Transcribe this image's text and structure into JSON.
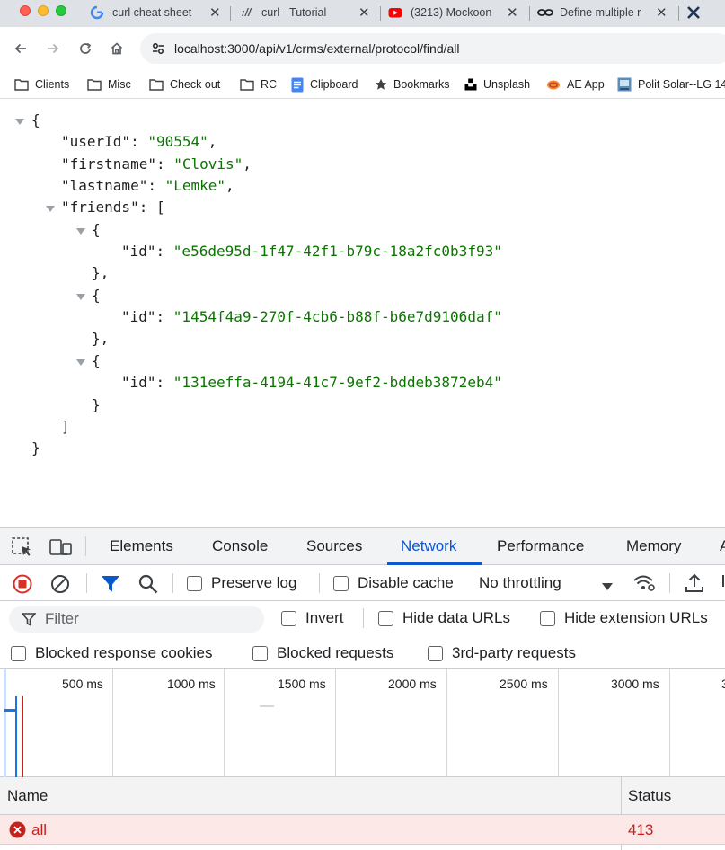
{
  "tabs": [
    {
      "title": "curl cheat sheet",
      "icon": "google-icon"
    },
    {
      "title": "curl - Tutorial",
      "icon": "slashes-icon"
    },
    {
      "title": "(3213) Mockoon",
      "icon": "youtube-icon"
    },
    {
      "title": "Define multiple r",
      "icon": "eye-link-icon"
    },
    {
      "title": "",
      "icon": "x-logo-icon"
    }
  ],
  "address": {
    "url": "localhost:3000/api/v1/crms/external/protocol/find/all"
  },
  "bookmarks": [
    {
      "label": "Clients",
      "icon": "folder-icon"
    },
    {
      "label": "Misc",
      "icon": "folder-icon"
    },
    {
      "label": "Check out",
      "icon": "folder-icon"
    },
    {
      "label": "RC",
      "icon": "folder-icon"
    },
    {
      "label": "Clipboard",
      "icon": "docs-icon"
    },
    {
      "label": "Bookmarks",
      "icon": "star-icon"
    },
    {
      "label": "Unsplash",
      "icon": "unsplash-icon"
    },
    {
      "label": "AE App",
      "icon": "ae-app-icon"
    },
    {
      "label": "Polit Solar--LG 14",
      "icon": "polit-solar-icon"
    }
  ],
  "json": {
    "open_brace": "{",
    "close_brace": "}",
    "userId_key": "\"userId\"",
    "userId_val": "\"90554\"",
    "firstname_key": "\"firstname\"",
    "firstname_val": "\"Clovis\"",
    "lastname_key": "\"lastname\"",
    "lastname_val": "\"Lemke\"",
    "friends_key": "\"friends\"",
    "open_bracket": "[",
    "close_bracket": "]",
    "id_key": "\"id\"",
    "friends": [
      {
        "id": "\"e56de95d-1f47-42f1-b79c-18a2fc0b3f93\""
      },
      {
        "id": "\"1454f4a9-270f-4cb6-b88f-b6e7d9106daf\""
      },
      {
        "id": "\"131eeffa-4194-41c7-9ef2-bddeb3872eb4\""
      }
    ]
  },
  "devtools": {
    "tabs": [
      "Elements",
      "Console",
      "Sources",
      "Network",
      "Performance",
      "Memory",
      "A"
    ],
    "active_tab": "Network",
    "toolbar": {
      "preserve_log": "Preserve log",
      "disable_cache": "Disable cache",
      "throttling": "No throttling"
    },
    "filter": {
      "placeholder": "Filter",
      "invert": "Invert",
      "hide_data_urls": "Hide data URLs",
      "hide_extension_urls": "Hide extension URLs"
    },
    "blocked": {
      "blocked_cookies": "Blocked response cookies",
      "blocked_requests": "Blocked requests",
      "third_party": "3rd-party requests"
    },
    "timeline_ticks": [
      "500 ms",
      "1000 ms",
      "1500 ms",
      "2000 ms",
      "2500 ms",
      "3000 ms",
      "3"
    ],
    "columns": {
      "name": "Name",
      "status": "Status"
    },
    "requests": [
      {
        "name": "all",
        "status": "413"
      }
    ],
    "colors": {
      "accent": "#0b57d0",
      "error": "#c5221f",
      "error_row": "#fce8e6"
    }
  }
}
